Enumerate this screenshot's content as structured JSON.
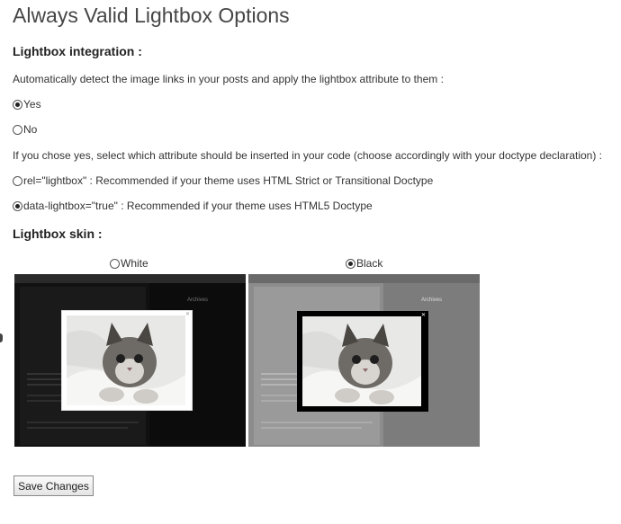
{
  "page": {
    "title": "Always Valid Lightbox Options"
  },
  "integration": {
    "heading": "Lightbox integration :",
    "description": "Automatically detect the image links in your posts and apply the lightbox attribute to them :",
    "options": [
      {
        "label": "Yes",
        "checked": true
      },
      {
        "label": "No",
        "checked": false
      }
    ],
    "attribute_question": "If you chose yes, select which attribute should be inserted in your code (choose accordingly with your doctype declaration) :",
    "attributes": [
      {
        "label": "rel=\"lightbox\" : Recommended if your theme uses HTML Strict or Transitional Doctype",
        "checked": false
      },
      {
        "label": "data-lightbox=\"true\" : Recommended if your theme uses HTML5 Doctype",
        "checked": true
      }
    ]
  },
  "skin": {
    "heading": "Lightbox skin :",
    "options": [
      {
        "label": "White",
        "checked": false
      },
      {
        "label": "Black",
        "checked": true
      }
    ],
    "preview_sidebar_title": "Archives"
  },
  "actions": {
    "save_label": "Save Changes"
  },
  "colors": {
    "radio_checked": "#222222",
    "text": "#333333",
    "title": "#464646"
  },
  "icons": {
    "radio_on": "radio-checked-icon",
    "radio_off": "radio-unchecked-icon",
    "close": "close-icon"
  }
}
